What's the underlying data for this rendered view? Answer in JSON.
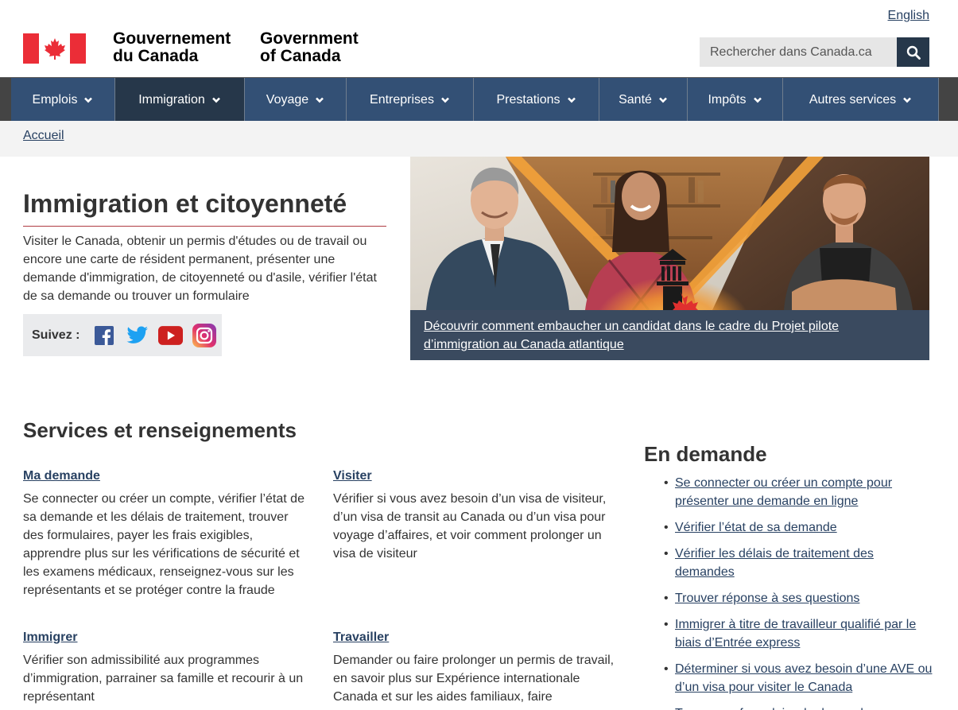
{
  "header": {
    "language_link": "English",
    "signature_fr": [
      "Gouvernement",
      "du Canada"
    ],
    "signature_en": [
      "Government",
      "of Canada"
    ],
    "search_placeholder": "Rechercher dans Canada.ca"
  },
  "nav": {
    "items": [
      {
        "label": "Emplois",
        "active": false
      },
      {
        "label": "Immigration",
        "active": true
      },
      {
        "label": "Voyage",
        "active": false
      },
      {
        "label": "Entreprises",
        "active": false
      },
      {
        "label": "Prestations",
        "active": false
      },
      {
        "label": "Santé",
        "active": false
      },
      {
        "label": "Impôts",
        "active": false
      },
      {
        "label": "Autres services",
        "active": false
      }
    ]
  },
  "breadcrumb": {
    "home": "Accueil"
  },
  "intro": {
    "title": "Immigration et citoyenneté",
    "description": "Visiter le Canada, obtenir un permis d'études ou de travail ou encore une carte de résident permanent, présenter une demande d'immigration, de citoyenneté ou d'asile, vérifier l'état de sa demande ou trouver un formulaire",
    "follow_label": "Suivez :",
    "social": [
      "facebook-icon",
      "twitter-icon",
      "youtube-icon",
      "instagram-icon"
    ]
  },
  "feature": {
    "caption": "Découvrir comment embaucher un candidat dans le cadre du Projet pilote d’immigration au Canada atlantique"
  },
  "services": {
    "title": "Services et renseignements",
    "items": [
      {
        "title": "Ma demande",
        "text": "Se connecter ou créer un compte, vérifier l’état de sa demande et les délais de traitement, trouver des formulaires, payer les frais exigibles, apprendre plus sur les vérifications de sécurité et les examens médicaux, renseignez-vous sur les représentants et se protéger contre la fraude"
      },
      {
        "title": "Visiter",
        "text": "Vérifier si vous avez besoin d’un visa de visiteur, d’un visa de transit au Canada ou d’un visa pour voyage d’affaires, et voir comment prolonger un visa de visiteur"
      },
      {
        "title": "Immigrer",
        "text": "Vérifier son admissibilité aux programmes d’immigration, parrainer sa famille et recourir à un représentant"
      },
      {
        "title": "Travailler",
        "text": "Demander ou faire prolonger un permis de travail, en savoir plus sur Expérience internationale Canada et sur les aides familiaux, faire"
      }
    ]
  },
  "in_demand": {
    "title": "En demande",
    "items": [
      "Se connecter ou créer un compte pour présenter une demande en ligne",
      "Vérifier l’état de sa demande",
      "Vérifier les délais de traitement des demandes",
      "Trouver réponse à ses questions",
      "Immigrer à titre de travailleur qualifié par le biais d’Entrée express",
      "Déterminer si vous avez besoin d’une AVE ou d’un visa pour visiter le Canada",
      "Trouver un formulaire de demande"
    ]
  },
  "colors": {
    "nav_bg": "#335075",
    "nav_active": "#26374a",
    "link": "#284162",
    "flag_red": "#eb2d37",
    "title_rule": "#af3c43"
  }
}
